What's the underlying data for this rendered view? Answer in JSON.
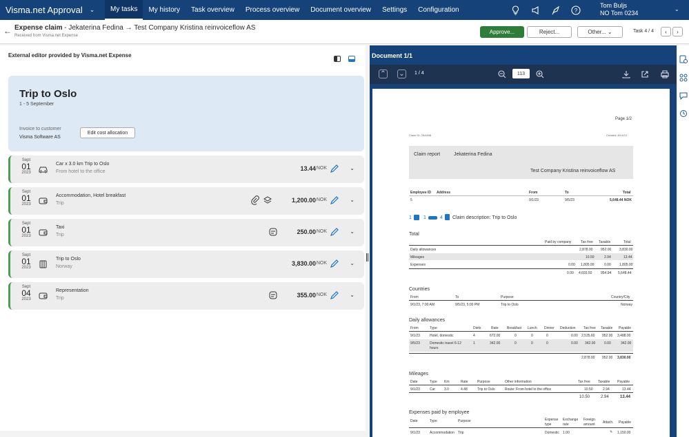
{
  "app": {
    "title": "Visma.net Approval"
  },
  "nav": [
    {
      "label": "My tasks",
      "active": true
    },
    {
      "label": "My history"
    },
    {
      "label": "Task overview"
    },
    {
      "label": "Process overview"
    },
    {
      "label": "Document overview"
    },
    {
      "label": "Settings"
    },
    {
      "label": "Configuration"
    }
  ],
  "user": {
    "name": "Tom Buljs",
    "company": "NO Tom 0234"
  },
  "header": {
    "title_bold": "Expense claim",
    "title_rest": " - Jekaterina Fedina → Test Company Kristina reinvoiceflow AS",
    "subtitle": "Received from Visma.net Expense",
    "approve": "Approve...",
    "reject": "Reject...",
    "other": "Other...",
    "task": "Task 4 / 4"
  },
  "editor": {
    "title": "External editor provided by Visma.net Expense"
  },
  "trip": {
    "title": "Trip to Oslo",
    "dates": "1 - 5 September",
    "invoice_label": "Invoice to customer",
    "invoice_value": "Visma Software AS",
    "cost_button": "Edit cost allocation"
  },
  "expenses": [
    {
      "month": "Sept",
      "day": "01",
      "year": "2023",
      "desc": "Car x 3.0 km Trip to Oslo",
      "sub": "From hotel to the office",
      "amount": "13.44",
      "currency": "NOK",
      "icon": "car-icon"
    },
    {
      "month": "Sept",
      "day": "01",
      "year": "2023",
      "desc": "Accommodation, Hotel breakfast",
      "sub": "Trip",
      "amount": "1,200.00",
      "currency": "NOK",
      "icon": "wallet-icon"
    },
    {
      "month": "Sept",
      "day": "01",
      "year": "2023",
      "desc": "Taxi",
      "sub": "Trip",
      "amount": "250.00",
      "currency": "NOK",
      "icon": "wallet-icon"
    },
    {
      "month": "Sept",
      "day": "01",
      "year": "2023",
      "desc": "Trip to Oslo",
      "sub": "Norway",
      "amount": "3,830.00",
      "currency": "NOK",
      "icon": "allowance-icon"
    },
    {
      "month": "Sept",
      "day": "04",
      "year": "2023",
      "desc": "Representation",
      "sub": "Trip",
      "amount": "355.00",
      "currency": "NOK",
      "icon": "wallet-icon"
    }
  ],
  "document": {
    "title": "Document 1/1",
    "page": "1 / 4",
    "zoom": "113",
    "p_page": "Page 1/2",
    "p_claimid": "Claim ID: 26/4458",
    "p_created": "Created: 8/14/23",
    "p_report": "Claim report",
    "p_name": "Jekaterina Fedina",
    "p_company": "Test Company Kristina reinvoiceflow AS",
    "p_hdr": [
      "Employee ID",
      "Address",
      "From",
      "To",
      "Total"
    ],
    "p_row": [
      "5",
      "9/1/23",
      "9/5/23",
      "5,648.44 NOK"
    ],
    "p_counts": [
      "1",
      "1",
      "4"
    ],
    "p_claimdesc": "Claim description: Trip to Oslo",
    "s_total": "Total",
    "t_hdr": [
      "Paid by company",
      "Tax free",
      "Taxable",
      "Total"
    ],
    "t_rows": [
      {
        "label": "Daily allowances",
        "a": "",
        "b": "2,878.00",
        "c": "952.00",
        "d": "3,830.00"
      },
      {
        "label": "Mileages",
        "a": "",
        "b": "10.50",
        "c": "2.94",
        "d": "13.44"
      },
      {
        "label": "Expenses",
        "a": "0.00",
        "b": "1,805.00",
        "c": "0.00",
        "d": "1,805.00"
      }
    ],
    "t_sum": [
      "0.00",
      "4,693.50",
      "954.94",
      "5,648.44"
    ],
    "s_countries": "Countries",
    "c_hdr": [
      "From",
      "To",
      "Purpose",
      "Country/City"
    ],
    "c_row": [
      "9/1/23, 7:00 AM",
      "9/5/23, 5:00 PM",
      "Trip to Oslo",
      "Norway"
    ],
    "s_daily": "Daily allowances",
    "d_hdr": [
      "From",
      "Type",
      "Diets",
      "Rate",
      "Breakfast",
      "Lunch",
      "Dinner",
      "Deduction",
      "Tax free",
      "Taxable",
      "Payable"
    ],
    "d_row1": [
      "9/1/23",
      "Hotel, domestic",
      "4",
      "672.00",
      "0",
      "0",
      "0",
      "0.00",
      "2,535.60",
      "952.00",
      "3,488.00"
    ],
    "d_row2": [
      "9/5/23",
      "Domestic travel 6-12",
      "1",
      "342.00",
      "0",
      "0",
      "0",
      "0.00",
      "342.00",
      "0.00",
      "342.00"
    ],
    "d_row2b": "hours",
    "d_sum": [
      "2,878.00",
      "952.00",
      "3,830.00"
    ],
    "s_mileages": "Mileages",
    "m_hdr": [
      "Date",
      "Type",
      "Km",
      "Rate",
      "Purpose",
      "Other information",
      "Tax free",
      "Taxable",
      "Payable"
    ],
    "m_row": [
      "9/1/23",
      "Car",
      "3.0",
      "4.48",
      "Trip to Oslo",
      "Route: From hotel to the office",
      "10.50",
      "2.94",
      "13.44"
    ],
    "m_sum": [
      "10.50",
      "2.94",
      "13.44"
    ],
    "s_expenses": "Expenses paid by employee",
    "e_hdr": [
      "Date",
      "Type",
      "Purpose",
      "Expense",
      "Exchange",
      "Foreign",
      "Attach.",
      "Payable"
    ],
    "e_hdr2": [
      "type",
      "rate",
      "amount"
    ],
    "e_row": [
      "9/1/23",
      "Accommodation",
      "Trip",
      "Domestic",
      "1.00",
      "1,150.00"
    ]
  }
}
